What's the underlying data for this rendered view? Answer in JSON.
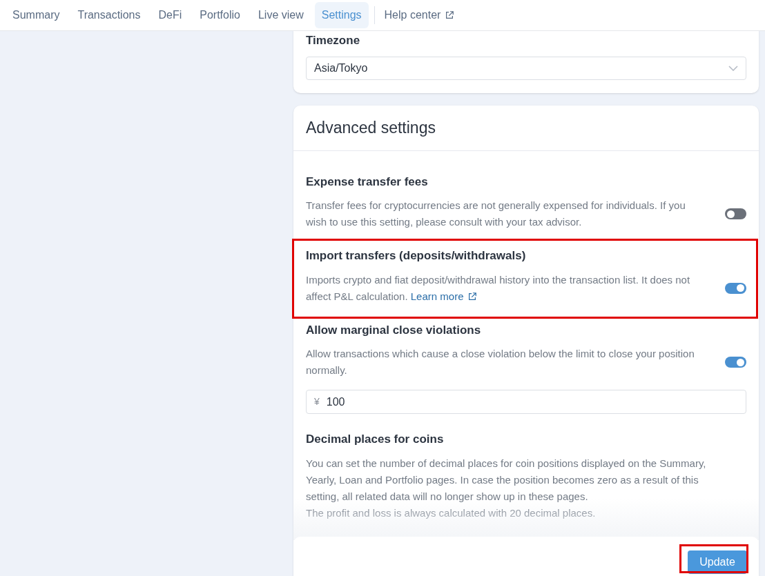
{
  "nav": {
    "tabs": [
      {
        "label": "Summary",
        "selected": false
      },
      {
        "label": "Transactions",
        "selected": false
      },
      {
        "label": "DeFi",
        "selected": false
      },
      {
        "label": "Portfolio",
        "selected": false
      },
      {
        "label": "Live view",
        "selected": false
      },
      {
        "label": "Settings",
        "selected": true
      }
    ],
    "help_link": "Help center"
  },
  "timezone": {
    "label": "Timezone",
    "value": "Asia/Tokyo"
  },
  "advanced": {
    "title": "Advanced settings",
    "items": [
      {
        "kind": "toggle",
        "title": "Expense transfer fees",
        "description": "Transfer fees for cryptocurrencies are not generally expensed for individuals. If you wish to use this setting, please consult with your tax advisor.",
        "on": false,
        "highlighted": false
      },
      {
        "kind": "toggle",
        "title": "Import transfers (deposits/withdrawals)",
        "description": "Imports crypto and fiat deposit/withdrawal history into the transaction list. It does not affect P&L calculation.",
        "link": "Learn more",
        "on": true,
        "highlighted": true
      },
      {
        "kind": "toggle",
        "title": "Allow marginal close violations",
        "description": "Allow transactions which cause a close violation below the limit to close your position normally.",
        "on": true,
        "highlighted": false,
        "amount": {
          "prefix": "¥",
          "value": "100"
        }
      },
      {
        "kind": "text",
        "title": "Decimal places for coins",
        "description": "You can set the number of decimal places for coin positions displayed on the Summary, Yearly, Loan and Portfolio pages. In case the position becomes zero as a result of this setting, all related data will no longer show up in these pages.",
        "note": "The profit and loss is always calculated with 20 decimal places.",
        "highlighted": false
      }
    ]
  },
  "update_button": {
    "label": "Update",
    "highlighted": true
  }
}
